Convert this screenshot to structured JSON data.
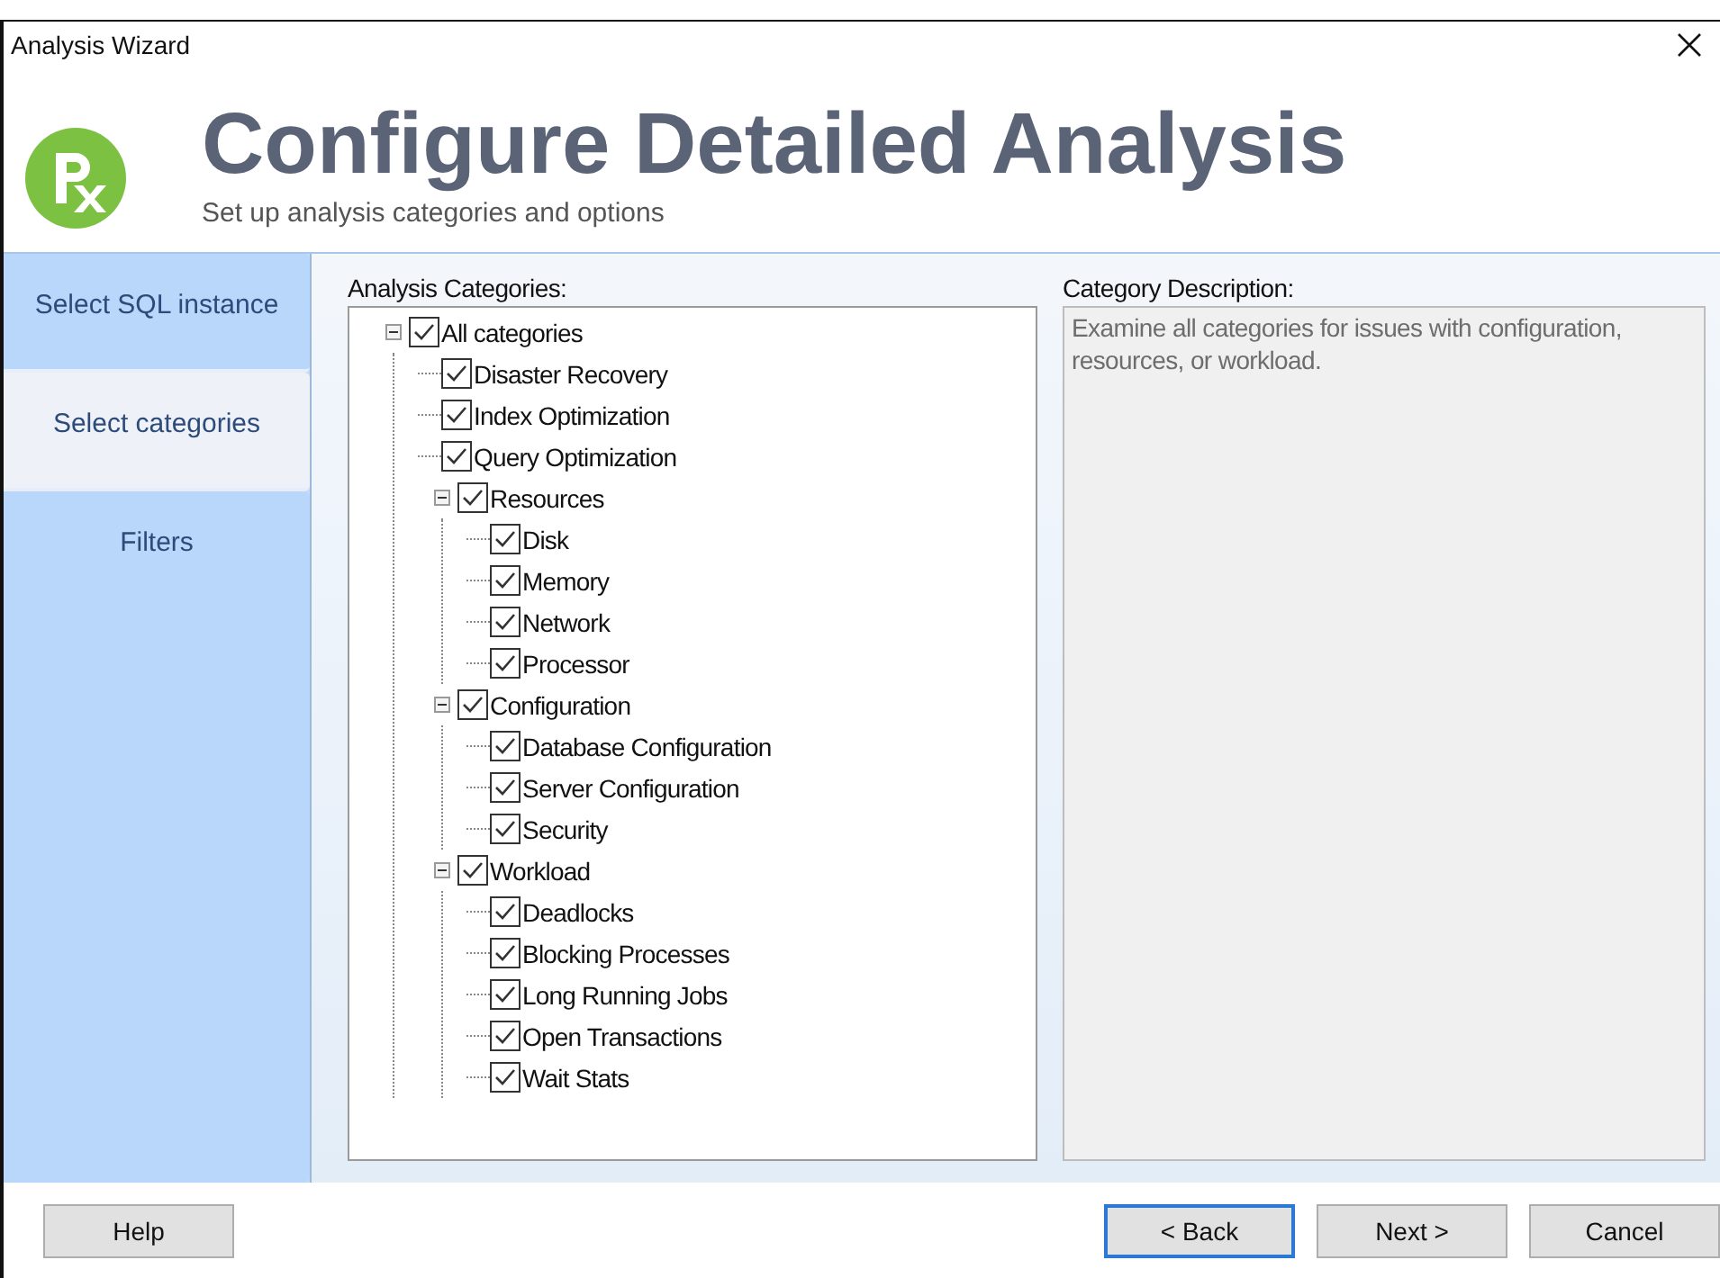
{
  "window": {
    "title": "Analysis Wizard"
  },
  "header": {
    "title": "Configure Detailed Analysis",
    "subtitle": "Set up analysis categories and options"
  },
  "steps": [
    {
      "label": "Select SQL instance",
      "selected": false
    },
    {
      "label": "Select categories",
      "selected": true
    },
    {
      "label": "Filters",
      "selected": false
    }
  ],
  "categories_label": "Analysis Categories:",
  "categories": [
    {
      "label": "All categories",
      "checked": true,
      "expanded": true,
      "children": [
        {
          "label": "Disaster Recovery",
          "checked": true
        },
        {
          "label": "Index Optimization",
          "checked": true
        },
        {
          "label": "Query Optimization",
          "checked": true
        },
        {
          "label": "Resources",
          "checked": true,
          "expanded": true,
          "children": [
            {
              "label": "Disk",
              "checked": true
            },
            {
              "label": "Memory",
              "checked": true
            },
            {
              "label": "Network",
              "checked": true
            },
            {
              "label": "Processor",
              "checked": true
            }
          ]
        },
        {
          "label": "Configuration",
          "checked": true,
          "expanded": true,
          "children": [
            {
              "label": "Database Configuration",
              "checked": true
            },
            {
              "label": "Server Configuration",
              "checked": true
            },
            {
              "label": "Security",
              "checked": true
            }
          ]
        },
        {
          "label": "Workload",
          "checked": true,
          "expanded": true,
          "children": [
            {
              "label": "Deadlocks",
              "checked": true
            },
            {
              "label": "Blocking Processes",
              "checked": true
            },
            {
              "label": "Long Running Jobs",
              "checked": true
            },
            {
              "label": "Open Transactions",
              "checked": true
            },
            {
              "label": "Wait Stats",
              "checked": true
            }
          ]
        }
      ]
    }
  ],
  "description_label": "Category Description:",
  "description": "Examine all categories for issues with configuration, resources, or workload.",
  "buttons": [
    {
      "label": "Help",
      "kind": "help",
      "selected": false
    },
    {
      "label": "< Back",
      "kind": "nav",
      "selected": true
    },
    {
      "label": "Next >",
      "kind": "nav",
      "selected": false
    },
    {
      "label": "Cancel",
      "kind": "nav",
      "selected": false
    }
  ]
}
